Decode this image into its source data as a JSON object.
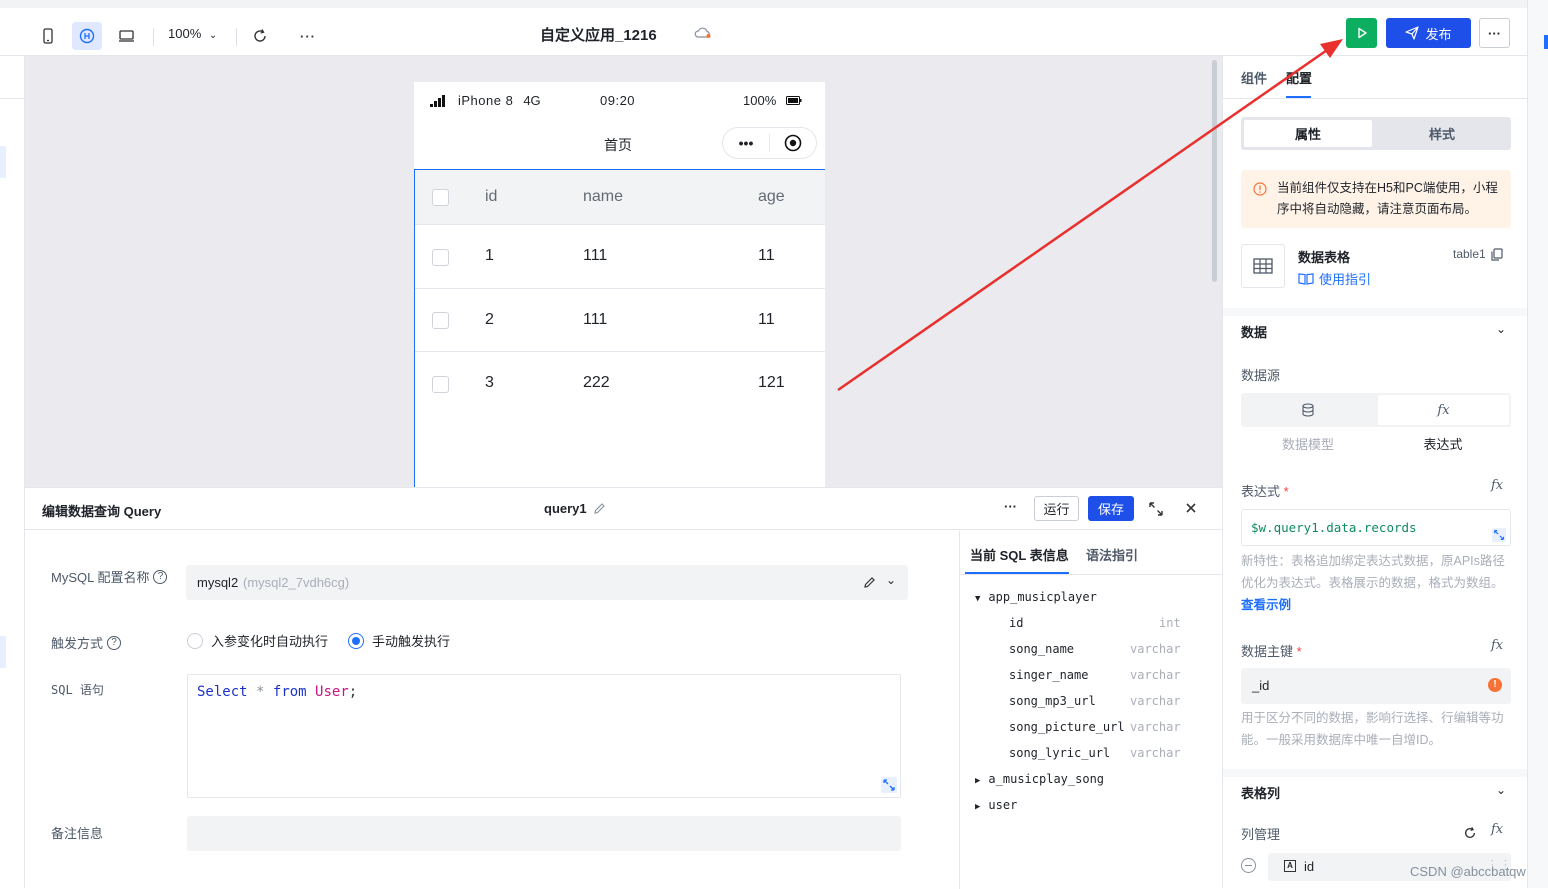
{
  "toolbar": {
    "zoom": "100%",
    "app_title": "自定义应用_1216",
    "publish_label": "发布",
    "more": "···"
  },
  "phone": {
    "device": "iPhone 8",
    "network": "4G",
    "time": "09:20",
    "battery": "100%",
    "page_title": "首页",
    "capsule_dots": "•••",
    "table": {
      "columns": [
        "id",
        "name",
        "age"
      ],
      "rows": [
        [
          "1",
          "111",
          "11"
        ],
        [
          "2",
          "111",
          "11"
        ],
        [
          "3",
          "222",
          "121"
        ]
      ]
    }
  },
  "query": {
    "panel_title": "编辑数据查询 Query",
    "name": "query1",
    "more": "···",
    "run_label": "运行",
    "save_label": "保存",
    "config_label": "MySQL 配置名称",
    "config_value": "mysql2",
    "config_value_id": "(mysql2_7vdh6cg)",
    "trigger_label": "触发方式",
    "trigger_option_auto": "入参变化时自动执行",
    "trigger_option_manual": "手动触发执行",
    "sql_label": "SQL 语句",
    "sql": {
      "kw1": "Select",
      "star": "*",
      "kw2": "from",
      "table": "User",
      "semi": ";"
    },
    "note_label": "备注信息",
    "side_tabs": [
      "当前 SQL 表信息",
      "语法指引"
    ],
    "tables": [
      {
        "name": "app_musicplayer",
        "expanded": true,
        "fields": [
          {
            "name": "id",
            "type": "int"
          },
          {
            "name": "song_name",
            "type": "varchar"
          },
          {
            "name": "singer_name",
            "type": "varchar"
          },
          {
            "name": "song_mp3_url",
            "type": "varchar"
          },
          {
            "name": "song_picture_url",
            "type": "varchar"
          },
          {
            "name": "song_lyric_url",
            "type": "varchar"
          }
        ]
      },
      {
        "name": "a_musicplay_song",
        "expanded": false
      },
      {
        "name": "user",
        "expanded": false
      }
    ]
  },
  "right": {
    "tabs": [
      "组件",
      "配置"
    ],
    "subtabs": [
      "属性",
      "样式"
    ],
    "notice": "当前组件仅支持在H5和PC端使用，小程序中将自动隐藏，请注意页面布局。",
    "component_name": "数据表格",
    "component_id": "table1",
    "guide_link": "使用指引",
    "data_section": "数据",
    "datasource_label": "数据源",
    "ds_options": [
      "数据模型",
      "表达式"
    ],
    "expr_label": "表达式",
    "required_mark": "*",
    "expr_value": "$w.query1.data.records",
    "expr_hint": "新特性：表格追加绑定表达式数据，原APIs路径优化为表达式。表格展示的数据，格式为数组。",
    "expr_hint_link": "查看示例",
    "pk_label": "数据主键",
    "pk_value": "_id",
    "pk_hint": "用于区分不同的数据，影响行选择、行编辑等功能。一般采用数据库中唯一自增ID。",
    "columns_section": "表格列",
    "col_manage_label": "列管理",
    "col_item": "id",
    "fx": "fx"
  },
  "watermark": "CSDN @abccbatqw",
  "colors": {
    "primary": "#1e6fff",
    "run_green": "#0cae5f",
    "arrow": "#e8302f",
    "warning": "#f77234"
  }
}
